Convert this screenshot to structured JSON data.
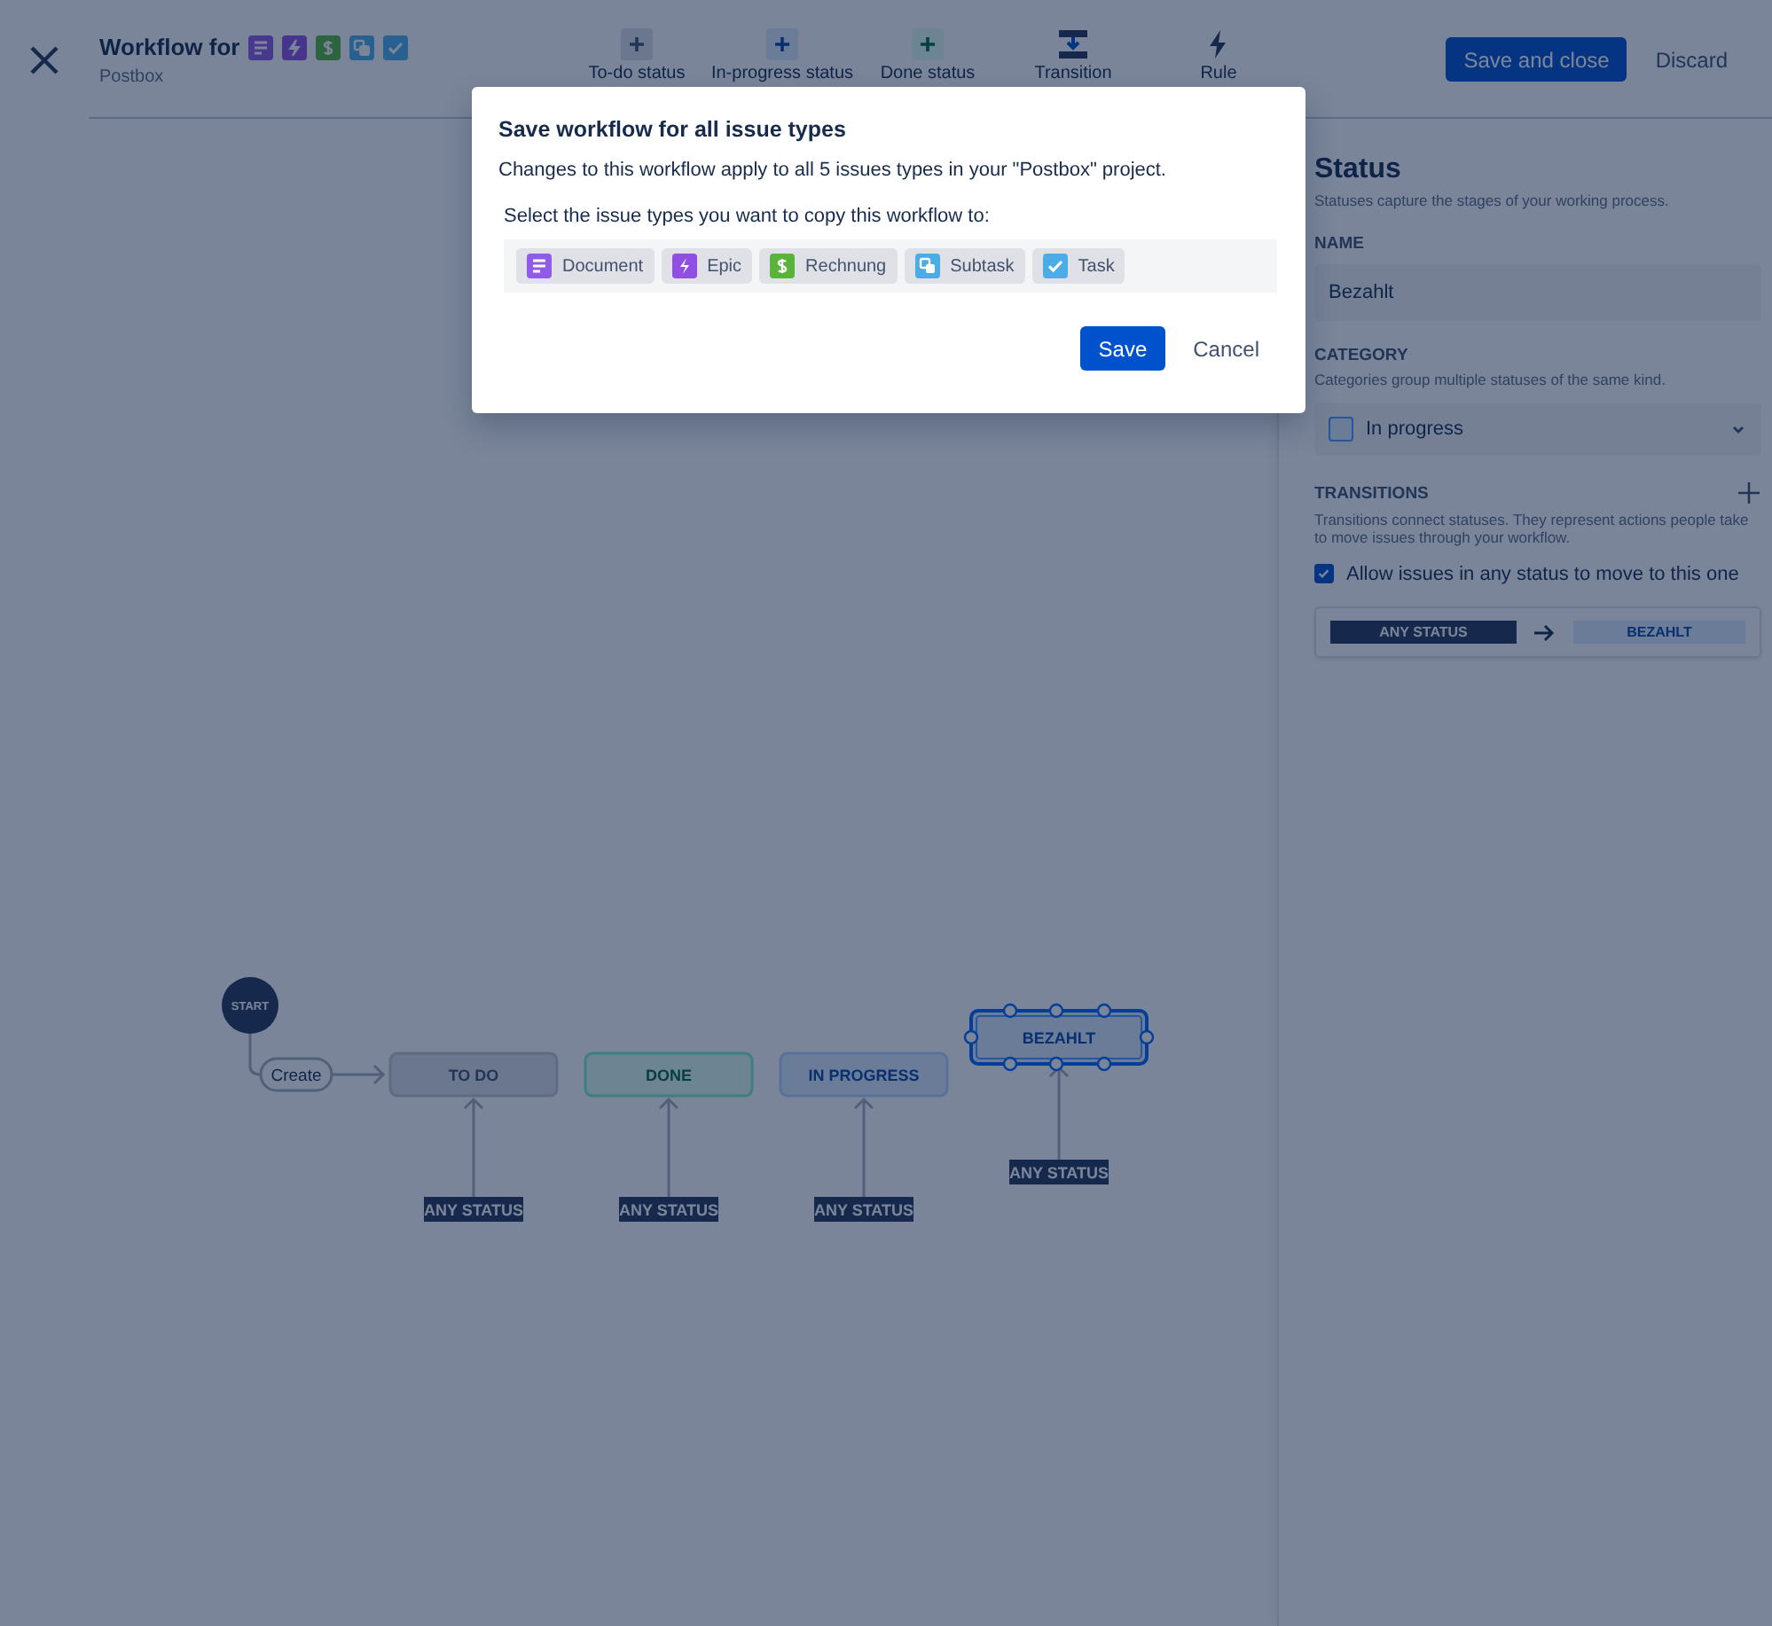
{
  "header": {
    "title": "Workflow for",
    "subtitle": "Postbox",
    "issue_types": [
      {
        "kind": "document",
        "color": "#473a8e"
      },
      {
        "kind": "epic",
        "color": "#47348c"
      },
      {
        "kind": "money",
        "color": "#2e633f"
      },
      {
        "kind": "subtask",
        "color": "#28608f"
      },
      {
        "kind": "task",
        "color": "#28608f"
      }
    ]
  },
  "toolbar": [
    {
      "kind": "todo",
      "label": "To-do status"
    },
    {
      "kind": "inprogress",
      "label": "In-progress status"
    },
    {
      "kind": "done",
      "label": "Done status"
    },
    {
      "kind": "transition",
      "label": "Transition"
    },
    {
      "kind": "rule",
      "label": "Rule"
    }
  ],
  "buttons": [
    {
      "kind": "primary",
      "label": "Save and close"
    },
    {
      "kind": "subtle",
      "label": "Discard"
    }
  ],
  "diagram": {
    "start": "START",
    "create": "Create",
    "statuses": [
      {
        "label": "TO DO",
        "kind": "todo",
        "selected": false,
        "any_status": "ANY STATUS"
      },
      {
        "label": "DONE",
        "kind": "done",
        "selected": false,
        "any_status": "ANY STATUS"
      },
      {
        "label": "IN PROGRESS",
        "kind": "inprogress",
        "selected": false,
        "any_status": "ANY STATUS"
      },
      {
        "label": "BEZAHLT",
        "kind": "inprogress",
        "selected": true,
        "any_status": "ANY STATUS"
      }
    ]
  },
  "panel": {
    "title": "Status",
    "description": "Statuses capture the stages of your working process.",
    "name_label": "NAME",
    "name_value": "Bezahlt",
    "category_label": "CATEGORY",
    "category_description": "Categories group multiple statuses of the same kind.",
    "category_value": "In progress",
    "transitions_label": "TRANSITIONS",
    "transitions_description": "Transitions connect statuses. They represent actions people take to move issues through your workflow.",
    "allow_any": {
      "label": "Allow issues in any status to move to this one",
      "checked": true
    },
    "transition": {
      "from": "ANY STATUS",
      "to": "BEZAHLT"
    }
  },
  "modal": {
    "title": "Save workflow for all issue types",
    "message": "Changes to this workflow apply to all 5 issues types in your \"Postbox\" project.",
    "prompt": "Select the issue types you want to copy this workflow to:",
    "issue_types": [
      {
        "label": "Document",
        "kind": "document",
        "color": "#8f5be8"
      },
      {
        "label": "Epic",
        "kind": "epic",
        "color": "#904ee2"
      },
      {
        "label": "Rechnung",
        "kind": "money",
        "color": "#5ab43a"
      },
      {
        "label": "Subtask",
        "kind": "subtask",
        "color": "#4bade8"
      },
      {
        "label": "Task",
        "kind": "task",
        "color": "#4bade8"
      }
    ],
    "buttons": [
      {
        "kind": "primary",
        "label": "Save"
      },
      {
        "kind": "subtle",
        "label": "Cancel"
      }
    ]
  }
}
